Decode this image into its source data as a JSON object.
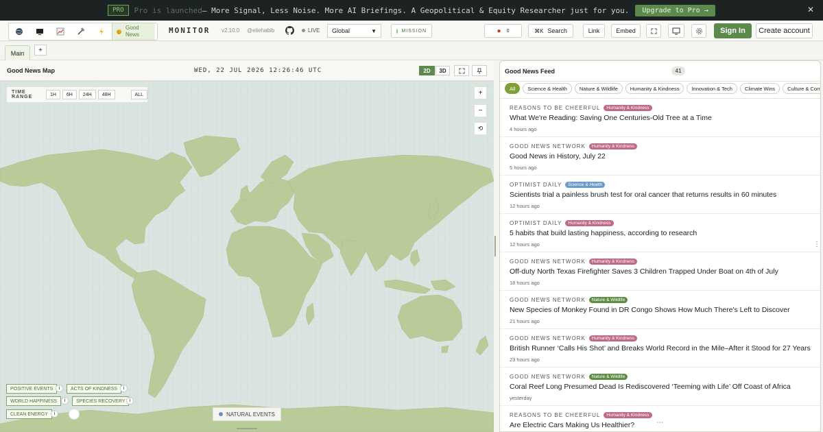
{
  "promo": {
    "tag": "PRO",
    "dim_text": "Pro is launched",
    "text": " — More Signal, Less Noise. More AI Briefings. A Geopolitical & Equity Researcher just for you.",
    "upgrade": "Upgrade to Pro →",
    "close": "✕"
  },
  "topbar": {
    "views": [
      "globe-view",
      "monitor-view",
      "finance-view",
      "tech-view",
      "energy-view"
    ],
    "active_view_label": "Good\nNews",
    "brand": "MONITOR",
    "version": "v2.10.0",
    "handle": "@eliehabib",
    "live": "LIVE",
    "region": "Global",
    "mission": "MISSION",
    "alerts": "0",
    "search_key": "⌘K",
    "search": "Search",
    "link": "Link",
    "embed": "Embed",
    "signin": "Sign In",
    "create": "Create account"
  },
  "tabs": {
    "main": "Main",
    "add": "+"
  },
  "map": {
    "title": "Good News Map",
    "clock": "WED, 22 JUL 2026 12:26:46 UTC",
    "mode_2d": "2D",
    "mode_3d": "3D",
    "time_range_label": "TIME RANGE",
    "time_range": [
      "1H",
      "6H",
      "24H",
      "48H"
    ],
    "time_all": "ALL",
    "layers": [
      "POSITIVE EVENTS",
      "ACTS OF KINDNESS",
      "WORLD HAPPINESS",
      "SPECIES RECOVERY",
      "CLEAN ENERGY"
    ],
    "info": "i",
    "natural": "NATURAL EVENTS",
    "colors": {
      "land": "#b9cb98",
      "ocean": "#dae5e2"
    }
  },
  "feed": {
    "title": "Good News Feed",
    "count": "41",
    "filters": [
      "All",
      "Science & Health",
      "Nature & Wildlife",
      "Humanity & Kindness",
      "Innovation & Tech",
      "Climate Wins",
      "Culture & Com"
    ],
    "items": [
      {
        "source": "REASONS TO BE CHEERFUL",
        "category": "Humanity & Kindness",
        "headline": "What We're Reading: Saving One Centuries-Old Tree at a Time",
        "time": "4 hours ago"
      },
      {
        "source": "GOOD NEWS NETWORK",
        "category": "Humanity & Kindness",
        "headline": "Good News in History, July 22",
        "time": "5 hours ago"
      },
      {
        "source": "OPTIMIST DAILY",
        "category": "Science & Health",
        "headline": "Scientists trial a painless brush test for oral cancer that returns results in 60 minutes",
        "time": "12 hours ago"
      },
      {
        "source": "OPTIMIST DAILY",
        "category": "Humanity & Kindness",
        "headline": "5 habits that build lasting happiness, according to research",
        "time": "12 hours ago"
      },
      {
        "source": "GOOD NEWS NETWORK",
        "category": "Humanity & Kindness",
        "headline": "Off-duty North Texas Firefighter Saves 3 Children Trapped Under Boat on 4th of July",
        "time": "18 hours ago"
      },
      {
        "source": "GOOD NEWS NETWORK",
        "category": "Nature & Wildlife",
        "headline": "New Species of Monkey Found in DR Congo Shows How Much There's Left to Discover",
        "time": "21 hours ago"
      },
      {
        "source": "GOOD NEWS NETWORK",
        "category": "Humanity & Kindness",
        "headline": "British Runner ‘Calls His Shot’ and Breaks World Record in the Mile–After it Stood for 27 Years",
        "time": "23 hours ago"
      },
      {
        "source": "GOOD NEWS NETWORK",
        "category": "Nature & Wildlife",
        "headline": "Coral Reef Long Presumed Dead Is Rediscovered ‘Teeming with Life’ Off Coast of Africa",
        "time": "yesterday"
      },
      {
        "source": "REASONS TO BE CHEERFUL",
        "category": "Humanity & Kindness",
        "headline": "Are Electric Cars Making Us Healthier?",
        "time": ""
      }
    ],
    "category_colors": {
      "Humanity & Kindness": "#c0698a",
      "Science & Health": "#6b9bc8",
      "Nature & Wildlife": "#5f8d43"
    }
  }
}
